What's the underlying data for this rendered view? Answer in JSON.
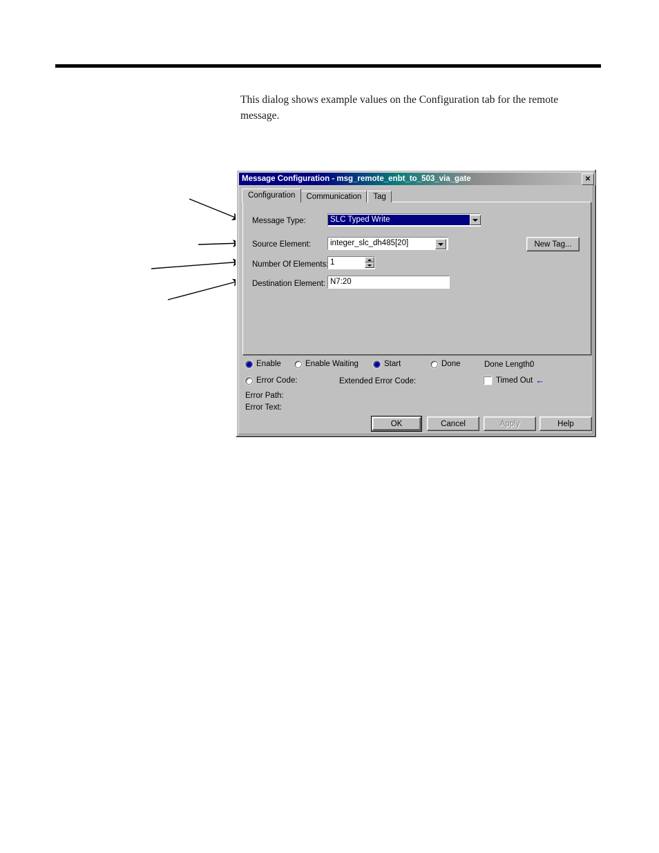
{
  "document": {
    "paragraph": "This dialog shows example values on the Configuration tab for the remote message."
  },
  "dialog": {
    "title": "Message Configuration - msg_remote_enbt_to_503_via_gate",
    "close_label": "✕",
    "tabs": [
      {
        "label": "Configuration",
        "active": true
      },
      {
        "label": "Communication",
        "active": false
      },
      {
        "label": "Tag",
        "active": false
      }
    ],
    "fields": {
      "message_type_label": "Message Type:",
      "message_type_value": "SLC Typed Write",
      "source_element_label": "Source Element:",
      "source_element_value": "integer_slc_dh485[20]",
      "number_of_elements_label": "Number Of Elements:",
      "number_of_elements_value": "1",
      "destination_element_label": "Destination Element:",
      "destination_element_value": "N7:20"
    },
    "new_tag_button": "New Tag...",
    "status": {
      "enable": "Enable",
      "enable_waiting": "Enable Waiting",
      "start": "Start",
      "done": "Done",
      "done_length_label": "Done Length:",
      "done_length_value": "0",
      "error_code": "Error Code:",
      "extended_error_code": "Extended Error Code:",
      "timed_out": "Timed Out",
      "timed_out_marker": "←",
      "error_path": "Error Path:",
      "error_text": "Error Text:"
    },
    "buttons": {
      "ok": "OK",
      "cancel": "Cancel",
      "apply": "Apply",
      "help": "Help"
    },
    "colors": {
      "titlebar_start": "#000080",
      "titlebar_mid": "#0b7a7a",
      "face": "#c0c0c0",
      "selection": "#000080",
      "radio_on": "#1414c8",
      "marker_arrow": "#0000cc"
    }
  }
}
